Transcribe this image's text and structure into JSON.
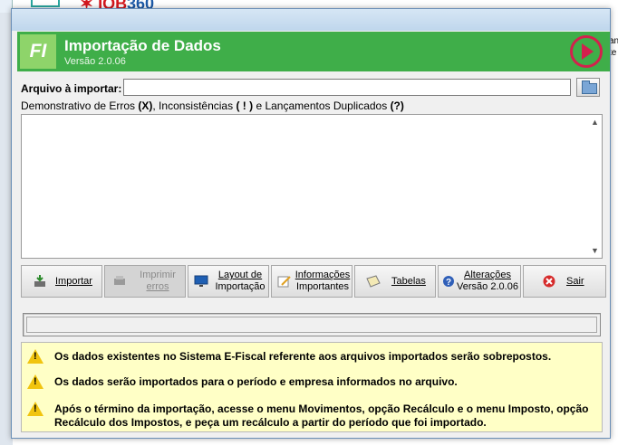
{
  "background": {
    "logo_text_red": "✶ IOB",
    "logo_text_blue": "360",
    "right_edge_texts": [
      "an",
      "te"
    ]
  },
  "header": {
    "badge": "FI",
    "title": "Importação de Dados",
    "version": "Versão 2.0.06",
    "accent_color": "#3fae49",
    "play_icon": "play-circle-icon"
  },
  "file": {
    "label": "Arquivo à importar:",
    "value": "",
    "browse_icon": "folder-open-icon"
  },
  "demo": {
    "prefix": "Demonstrativo de Erros",
    "err_symbol": "(X)",
    "mid": ", Inconsistências",
    "inc_symbol": "( ! )",
    "mid2": "e Lançamentos Duplicados",
    "dup_symbol": "(?)"
  },
  "toolbar": {
    "importar": "Importar",
    "imprimir_line1": "Imprimir",
    "imprimir_line2": "erros",
    "layout_line1": "Layout de",
    "layout_line2": "Importação",
    "info_line1": "Informações",
    "info_line2": "Importantes",
    "tabelas": "Tabelas",
    "alteracoes_line1": "Alterações",
    "alteracoes_line2": "Versão 2.0.06",
    "sair": "Sair"
  },
  "warnings": [
    "Os dados existentes no Sistema E-Fiscal referente aos arquivos importados serão sobrepostos.",
    "Os dados serão importados para o período e empresa informados no arquivo.",
    "Após o término da importação, acesse o menu Movimentos, opção Recálculo e o menu Imposto, opção",
    "Recálculo dos Impostos, e peça um recálculo a partir do período que foi importado."
  ]
}
